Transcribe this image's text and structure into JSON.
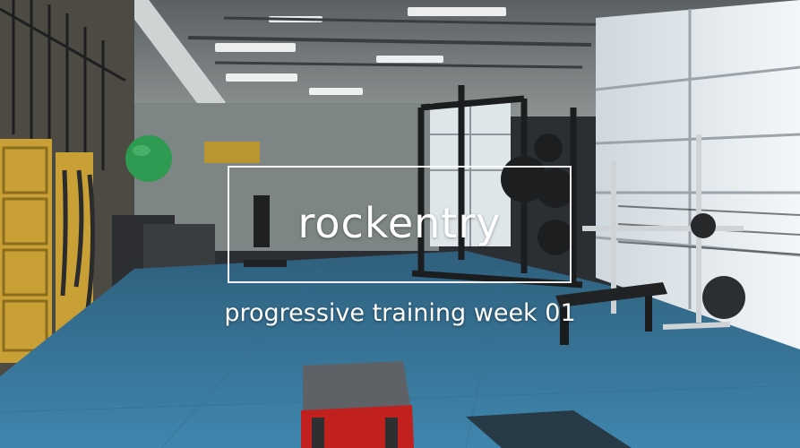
{
  "overlay": {
    "title": "rockentry",
    "subtitle": "progressive training week 01"
  },
  "colors": {
    "floor": "#3d7fa6",
    "wall": "#7c8483",
    "window": "#e8eef2",
    "ball": "#2f9a52",
    "box_frame": "#c0201e",
    "cubby": "#c9a035"
  }
}
